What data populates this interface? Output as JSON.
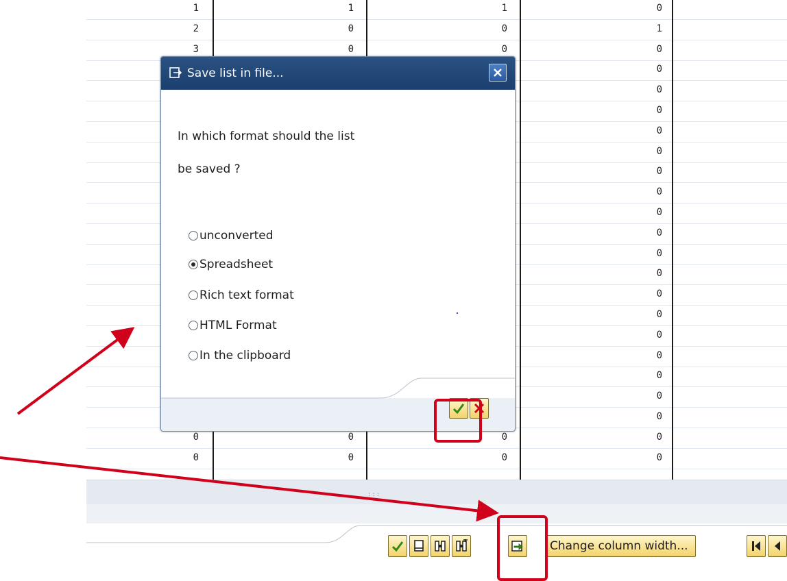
{
  "list": {
    "col1": [
      "1",
      "2",
      "3",
      "",
      "",
      "",
      "",
      "",
      "",
      "",
      "",
      "",
      "",
      "",
      "",
      "",
      "",
      "",
      "",
      "",
      "",
      "0",
      "0"
    ],
    "col2": [
      "1",
      "0",
      "0",
      "",
      "",
      "",
      "",
      "",
      "",
      "",
      "",
      "",
      "",
      "",
      "",
      "",
      "",
      "",
      "",
      "",
      "",
      "0",
      "0"
    ],
    "col3": [
      "1",
      "0",
      "0",
      "",
      "",
      "",
      "",
      "",
      "",
      "",
      "",
      "",
      "",
      "",
      "",
      "",
      "",
      "",
      "",
      "",
      "",
      "0",
      "0"
    ],
    "col4": [
      "0",
      "1",
      "0",
      "0",
      "0",
      "0",
      "0",
      "0",
      "0",
      "0",
      "0",
      "0",
      "0",
      "0",
      "0",
      "0",
      "0",
      "0",
      "0",
      "0",
      "0",
      "0",
      "0"
    ]
  },
  "dialog": {
    "title": "Save list in file...",
    "question_line1": "In which format should the list",
    "question_line2": "be saved ?",
    "options": [
      {
        "label": "unconverted",
        "selected": false
      },
      {
        "label": "Spreadsheet",
        "selected": true
      },
      {
        "label": "Rich text format",
        "selected": false
      },
      {
        "label": "HTML Format",
        "selected": false
      },
      {
        "label": "In the clipboard",
        "selected": false
      }
    ],
    "continue_icon": "checkmark-icon",
    "cancel_icon": "cancel-x-icon",
    "close_icon": "close-icon"
  },
  "toolbar": {
    "buttons": [
      "checkmark-icon",
      "print-icon",
      "find-icon",
      "find-next-icon",
      "export-local-file-icon"
    ],
    "change_column_width": "Change column width...",
    "nav": [
      "first-page-icon",
      "previous-page-icon"
    ]
  },
  "colors": {
    "title_bar": "#1b3f6e",
    "button_fill": "#f3d36a",
    "highlight": "#d0021b",
    "check_green": "#2f8a1a",
    "cancel_red": "#d0021b"
  }
}
